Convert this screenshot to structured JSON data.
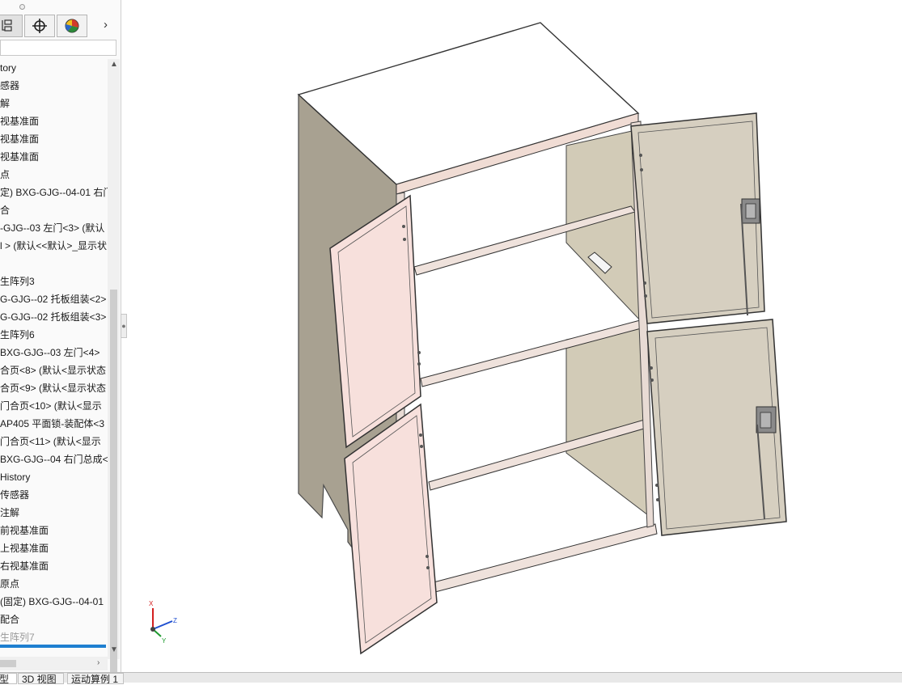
{
  "feature_manager": {
    "tabs": [
      {
        "name": "feature-tree-tab",
        "icon": "feature-tree-icon"
      },
      {
        "name": "configuration-tab",
        "icon": "crosshair-icon"
      },
      {
        "name": "display-manager-tab",
        "icon": "appearance-pie-icon"
      }
    ],
    "more_arrow": "›",
    "tree_items": [
      "tory",
      "感器",
      "解",
      "视基准面",
      "视基准面",
      "视基准面",
      "点",
      "定) BXG-GJG--04-01 右门",
      "合",
      "-GJG--03 左门<3> (默认",
      "l > (默认<<默认>_显示状",
      "",
      "生阵列3",
      "G-GJG--02 托板组装<2>",
      "G-GJG--02 托板组装<3>",
      "生阵列6",
      "BXG-GJG--03 左门<4>",
      "合页<8> (默认<显示状态",
      "合页<9> (默认<显示状态",
      "门合页<10> (默认<显示",
      "AP405 平面锁-装配体<3",
      "门合页<11> (默认<显示",
      "BXG-GJG--04 右门总成<",
      " History",
      " 传感器",
      " 注解",
      " 前视基准面",
      " 上视基准面",
      " 右视基准面",
      " 原点",
      " (固定) BXG-GJG--04-01",
      " 配合",
      "生阵列7"
    ]
  },
  "bottom_tabs": [
    "型",
    "3D 视图",
    "运动算例 1"
  ],
  "triad": {
    "x": "X",
    "y": "Y",
    "z": "Z"
  },
  "colors": {
    "accent_blue": "#1e7fd0",
    "door_pink": "#f7e0dc",
    "door_beige": "#d6cfc0",
    "side_panel": "#a8a191",
    "frame_edge": "#ecdcd4"
  }
}
